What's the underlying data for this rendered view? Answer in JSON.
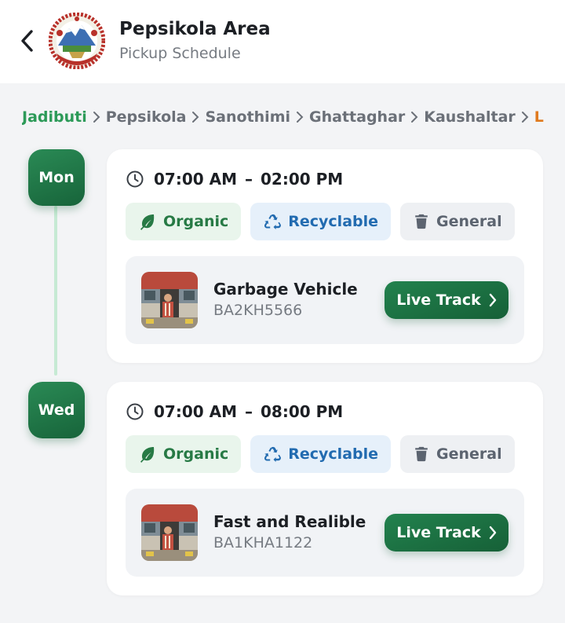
{
  "header": {
    "title": "Pepsikola Area",
    "subtitle": "Pickup Schedule",
    "back_icon": "chevron-left-icon",
    "emblem": "nepal-emblem-logo"
  },
  "breadcrumbs": [
    "Jadibuti",
    "Pepsikola",
    "Sanothimi",
    "Ghattaghar",
    "Kaushaltar",
    "L"
  ],
  "colors": {
    "primary_green": "#1f7a47",
    "active_crumb": "#2c9a58",
    "last_crumb": "#e07a1e",
    "organic": "#277a45",
    "recyclable": "#226bb0",
    "general": "#5c6470"
  },
  "schedule": [
    {
      "day": "Mon",
      "time_start": "07:00 AM",
      "time_sep": "–",
      "time_end": "02:00 PM",
      "chips": [
        "Organic",
        "Recyclable",
        "General"
      ],
      "vehicle": {
        "name": "Garbage Vehicle",
        "plate": "BA2KH5566",
        "button": "Live Track"
      }
    },
    {
      "day": "Wed",
      "time_start": "07:00 AM",
      "time_sep": "–",
      "time_end": "08:00 PM",
      "chips": [
        "Organic",
        "Recyclable",
        "General"
      ],
      "vehicle": {
        "name": "Fast and Realible",
        "plate": "BA1KHA1122",
        "button": "Live Track"
      }
    }
  ]
}
